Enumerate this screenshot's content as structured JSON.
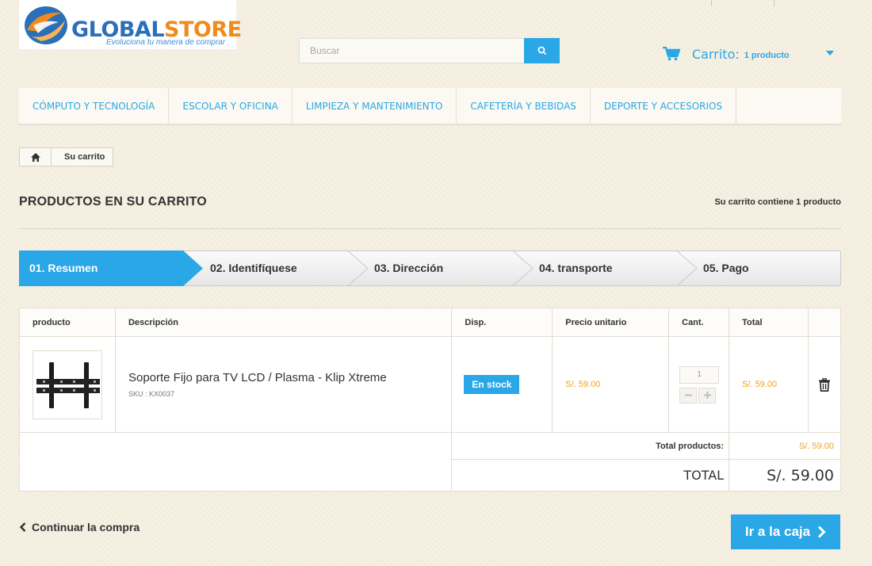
{
  "header": {
    "logo_text_part1": "GLOBAL",
    "logo_text_part2": "STORE",
    "logo_tagline": "Evoluciona tu manera de comprar",
    "search_placeholder": "Buscar",
    "cart_title": "Carrito:",
    "cart_count": "1 producto"
  },
  "nav": [
    "CÓMPUTO Y TECNOLOGÍA",
    "ESCOLAR Y OFICINA",
    "LIMPIEZA Y MANTENIMIENTO",
    "CAFETERÍA Y BEBIDAS",
    "DEPORTE Y ACCESORIOS"
  ],
  "breadcrumb": {
    "current": "Su carrito"
  },
  "page": {
    "title": "PRODUCTOS EN SU CARRITO",
    "summary": "Su carrito contiene 1 producto"
  },
  "steps": [
    "01. Resumen",
    "02. Identifíquese",
    "03. Dirección",
    "04. transporte",
    "05. Pago"
  ],
  "table": {
    "headers": [
      "producto",
      "Descripción",
      "Disp.",
      "Precio unitario",
      "Cant.",
      "Total"
    ],
    "item": {
      "name": "Soporte Fijo para TV LCD / Plasma - Klip Xtreme",
      "sku": "SKU : KX0037",
      "availability": "En stock",
      "unit_price": "S/. 59.00",
      "quantity": "1",
      "total": "S/. 59.00"
    },
    "total_products_label": "Total productos:",
    "total_products_value": "S/. 59.00",
    "total_label": "TOTAL",
    "total_value": "S/. 59.00"
  },
  "actions": {
    "continue": "Continuar la compra",
    "checkout": "Ir a la caja"
  },
  "colors": {
    "accent": "#2aa7e6",
    "price": "#f0a219",
    "logo_blue": "#2a6fb8",
    "logo_orange": "#f08a1c"
  }
}
